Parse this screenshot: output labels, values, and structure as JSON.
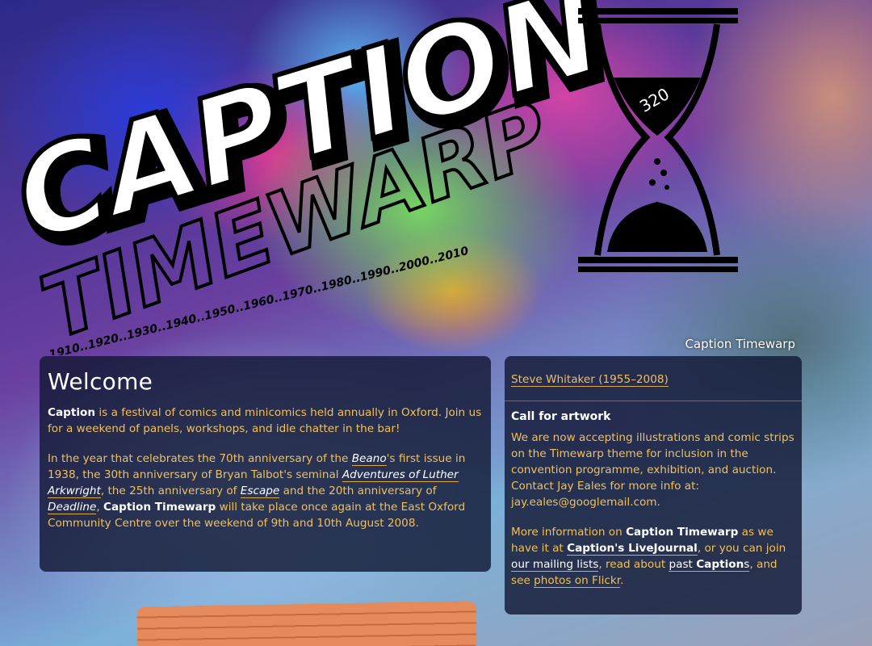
{
  "logo": {
    "word1": "CAPTION",
    "word2": "TIMEWARP",
    "decades": "1910..1920..1930..1940..1950..1960..1970..1980..1990..2000..2010",
    "hourglass_number": "320",
    "colors": {
      "stroke": "#000000",
      "fill": "#ffffff"
    }
  },
  "photo_caption": "Caption Timewarp",
  "welcome": {
    "title": "Welcome",
    "p1": {
      "caption": "Caption",
      "rest": " is a festival of comics and minicomics held annually in Oxford. Join us for a weekend of panels, workshops, and idle chatter in the bar!"
    },
    "p2": {
      "t1": "In the year that celebrates the 70th anniversary of the ",
      "beano": "Beano",
      "t2": "'s first issue in 1938, the 30th anniversary of Bryan Talbot's seminal ",
      "arkwright": "Adventures of Luther Arkwright",
      "t3": ", the 25th anniversary of ",
      "escape": "Escape",
      "t4": " and the 20th anniversary of ",
      "deadline": "Deadline",
      "t5": ", ",
      "timewarp": "Caption Timewarp",
      "t6": " will take place once again at the East Oxford Community Centre over the weekend of 9th and 10th August 2008."
    }
  },
  "sidebar": {
    "steve_link": "Steve Whitaker (1955–2008)",
    "call_title": "Call for artwork",
    "call_body": "We are now accepting illustrations and comic strips on the Timewarp theme for inclusion in the convention programme, exhibition, and auction. Contact Jay Eales for more info at: jay.eales@googlemail.com.",
    "more": {
      "t1": "More information on ",
      "timewarp": "Caption Timewarp",
      "t2": " as we have it at ",
      "lj": "Caption's LiveJournal",
      "t3": ", or you can join ",
      "lists": "our mailing lists",
      "t4": ", read about ",
      "past": "past ",
      "past_caption": "Caption",
      "past_s": "s",
      "t5": ", and see ",
      "flickr": "photos on Flickr",
      "t6": "."
    }
  },
  "colors": {
    "accent": "#f0c05a",
    "panel_bg": "#121834",
    "heading": "#ffffff"
  }
}
